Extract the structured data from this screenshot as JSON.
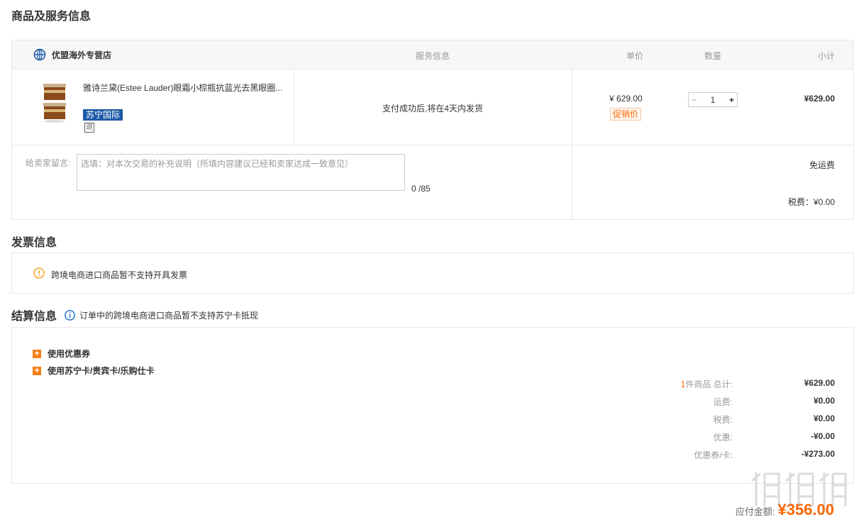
{
  "goods_section": {
    "title": "商品及服务信息",
    "store_name": "优盟海外专营店",
    "col_service": "服务信息",
    "col_price": "单价",
    "col_qty": "数量",
    "col_subtotal": "小计",
    "product_name": "雅诗兰黛(Estee Lauder)眼霜小棕瓶抗蓝光去黑眼圈...",
    "intl_badge": "苏宁国际",
    "return_icon": "退",
    "service_text": "支付成功后,将在4天内发货",
    "unit_price": "¥ 629.00",
    "promo_label": "促销价",
    "qty_minus": "−",
    "qty_value": "1",
    "qty_plus": "+",
    "subtotal": "¥629.00",
    "message_label": "给卖家留言:",
    "message_placeholder": "选填：对本次交易的补充说明（所填内容建议已经和卖家达成一致意见）",
    "message_count": "0 /85",
    "shipping": "免运费",
    "tax": "税费：¥0.00"
  },
  "invoice_section": {
    "title": "发票信息",
    "notice": "跨境电商进口商品暂不支持开具发票"
  },
  "settlement_section": {
    "title": "结算信息",
    "note": "订单中的跨境电商进口商品暂不支持苏宁卡抵现",
    "option_coupon": "使用优惠券",
    "option_card": "使用苏宁卡/贵宾卡/乐购仕卡",
    "summary": {
      "count_prefix": "1",
      "count_label": "件商品 总计:",
      "total": "¥629.00",
      "freight_label": "运费:",
      "freight": "¥0.00",
      "tax_label": "税费:",
      "tax": "¥0.00",
      "discount_label": "优惠:",
      "discount": "-¥0.00",
      "coupon_label": "优惠券/卡:",
      "coupon": "-¥273.00"
    },
    "pay_label": "应付金额:",
    "pay_amount": "¥356.00"
  },
  "colors": {
    "accent_orange": "#f57f17",
    "price_orange": "#ff6600",
    "intl_blue": "#1e5aa8",
    "info_blue": "#2a78d2"
  }
}
